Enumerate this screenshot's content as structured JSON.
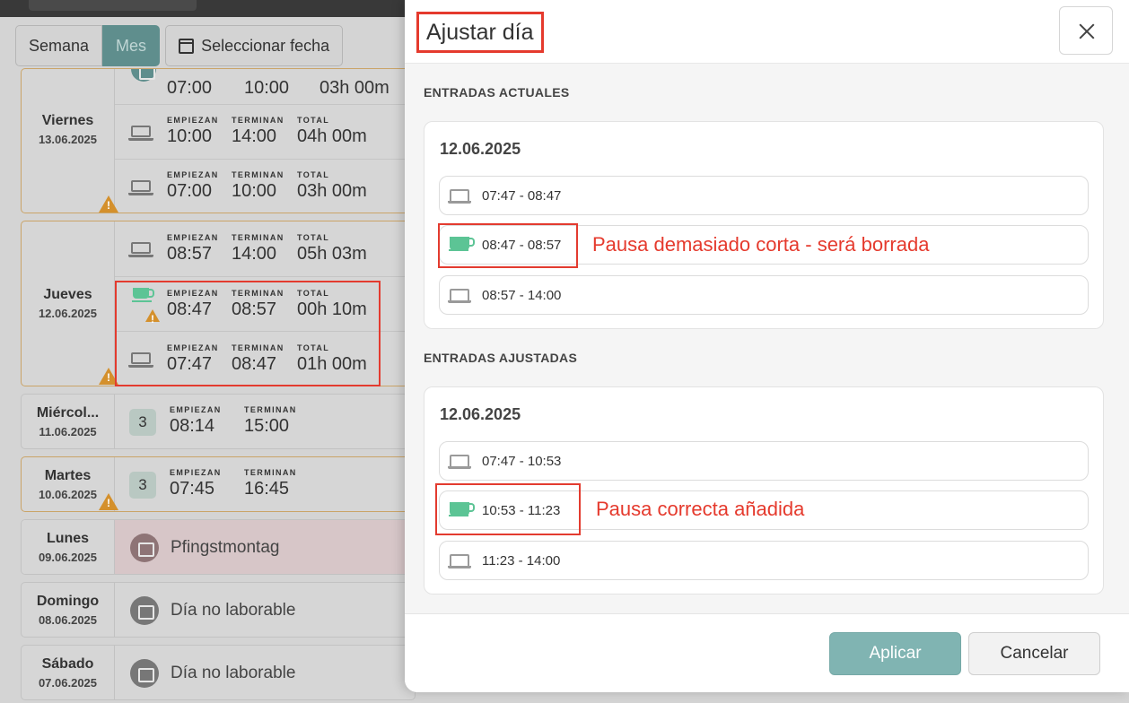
{
  "view": {
    "week_label": "Semana",
    "month_label": "Mes",
    "select_date_label": "Seleccionar fecha"
  },
  "days": {
    "viernes": {
      "name": "Viernes",
      "date": "13.06.2025",
      "partial": {
        "start": "07:00",
        "end": "10:00",
        "total": "03h 00m"
      },
      "entries": [
        {
          "start_label": "EMPIEZAN",
          "end_label": "TERMINAN",
          "total_label": "TOTAL",
          "start": "10:00",
          "end": "14:00",
          "total": "04h 00m"
        },
        {
          "start_label": "EMPIEZAN",
          "end_label": "TERMINAN",
          "total_label": "TOTAL",
          "start": "07:00",
          "end": "10:00",
          "total": "03h 00m"
        }
      ]
    },
    "jueves": {
      "name": "Jueves",
      "date": "12.06.2025",
      "entries": [
        {
          "start_label": "EMPIEZAN",
          "end_label": "TERMINAN",
          "total_label": "TOTAL",
          "start": "08:57",
          "end": "14:00",
          "total": "05h 03m"
        },
        {
          "start_label": "EMPIEZAN",
          "end_label": "TERMINAN",
          "total_label": "TOTAL",
          "start": "08:47",
          "end": "08:57",
          "total": "00h 10m"
        },
        {
          "start_label": "EMPIEZAN",
          "end_label": "TERMINAN",
          "total_label": "TOTAL",
          "start": "07:47",
          "end": "08:47",
          "total": "01h 00m"
        }
      ]
    },
    "miercoles": {
      "name": "Miércol...",
      "date": "11.06.2025",
      "count": "3",
      "start_label": "EMPIEZAN",
      "end_label": "TERMINAN",
      "start": "08:14",
      "end": "15:00"
    },
    "martes": {
      "name": "Martes",
      "date": "10.06.2025",
      "count": "3",
      "start_label": "EMPIEZAN",
      "end_label": "TERMINAN",
      "start": "07:45",
      "end": "16:45"
    },
    "lunes": {
      "name": "Lunes",
      "date": "09.06.2025",
      "text": "Pfingstmontag"
    },
    "domingo": {
      "name": "Domingo",
      "date": "08.06.2025",
      "text": "Día no laborable"
    },
    "sabado": {
      "name": "Sábado",
      "date": "07.06.2025",
      "text": "Día no laborable"
    }
  },
  "modal": {
    "title": "Ajustar día",
    "current_heading": "ENTRADAS ACTUALES",
    "current_date": "12.06.2025",
    "current_entries": [
      "07:47 - 08:47",
      "08:47 - 08:57",
      "08:57 - 14:00"
    ],
    "current_annotation": "Pausa demasiado corta - será borrada",
    "adjusted_heading": "ENTRADAS AJUSTADAS",
    "adjusted_date": "12.06.2025",
    "adjusted_entries": [
      "07:47 - 10:53",
      "10:53 - 11:23",
      "11:23 - 14:00"
    ],
    "adjusted_annotation": "Pausa correcta añadida",
    "apply_label": "Aplicar",
    "cancel_label": "Cancelar"
  },
  "colors": {
    "accent": "#80b4b2",
    "annotation_red": "#e53a2d",
    "break_green": "#5cc495",
    "warning": "#d4902c"
  }
}
